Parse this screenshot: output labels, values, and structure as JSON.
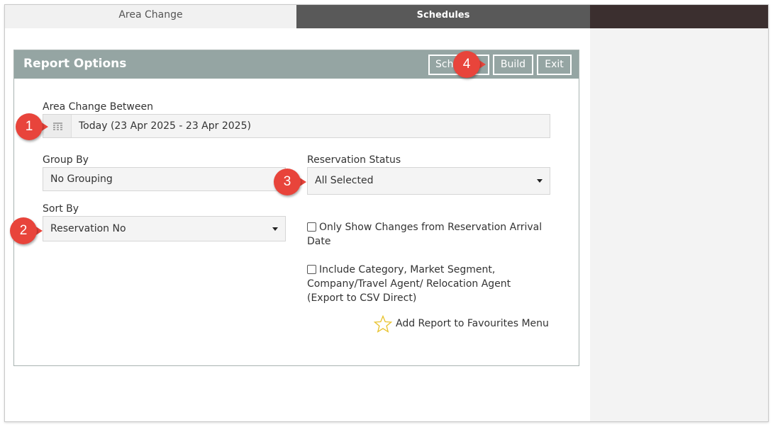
{
  "tabs": [
    {
      "label": "Area Change",
      "active": true
    },
    {
      "label": "Schedules",
      "active": false
    }
  ],
  "panel": {
    "title": "Report Options",
    "buttons": {
      "schedule": "Schedule",
      "build": "Build",
      "exit": "Exit"
    }
  },
  "form": {
    "date_label": "Area Change Between",
    "date_value": "Today (23 Apr 2025 - 23 Apr 2025)",
    "group_by_label": "Group By",
    "group_by_value": "No Grouping",
    "reservation_status_label": "Reservation Status",
    "reservation_status_value": "All Selected",
    "sort_by_label": "Sort By",
    "sort_by_value": "Reservation No",
    "only_show_changes_label": "Only Show Changes from Reservation Arrival Date",
    "only_show_changes_checked": false,
    "include_category_label": "Include Category, Market Segment, Company/Travel Agent/ Relocation Agent (Export to CSV Direct)",
    "include_category_checked": false,
    "favourites_label": "Add Report to Favourites Menu"
  },
  "callouts": [
    "1",
    "2",
    "3",
    "4"
  ],
  "colors": {
    "header_bg": "#95a5a3",
    "callout": "#e8443b",
    "tab_dark": "#595959",
    "star": "#e8c22a"
  },
  "icons": [
    "calendar-icon",
    "caret-down-icon",
    "star-icon"
  ]
}
